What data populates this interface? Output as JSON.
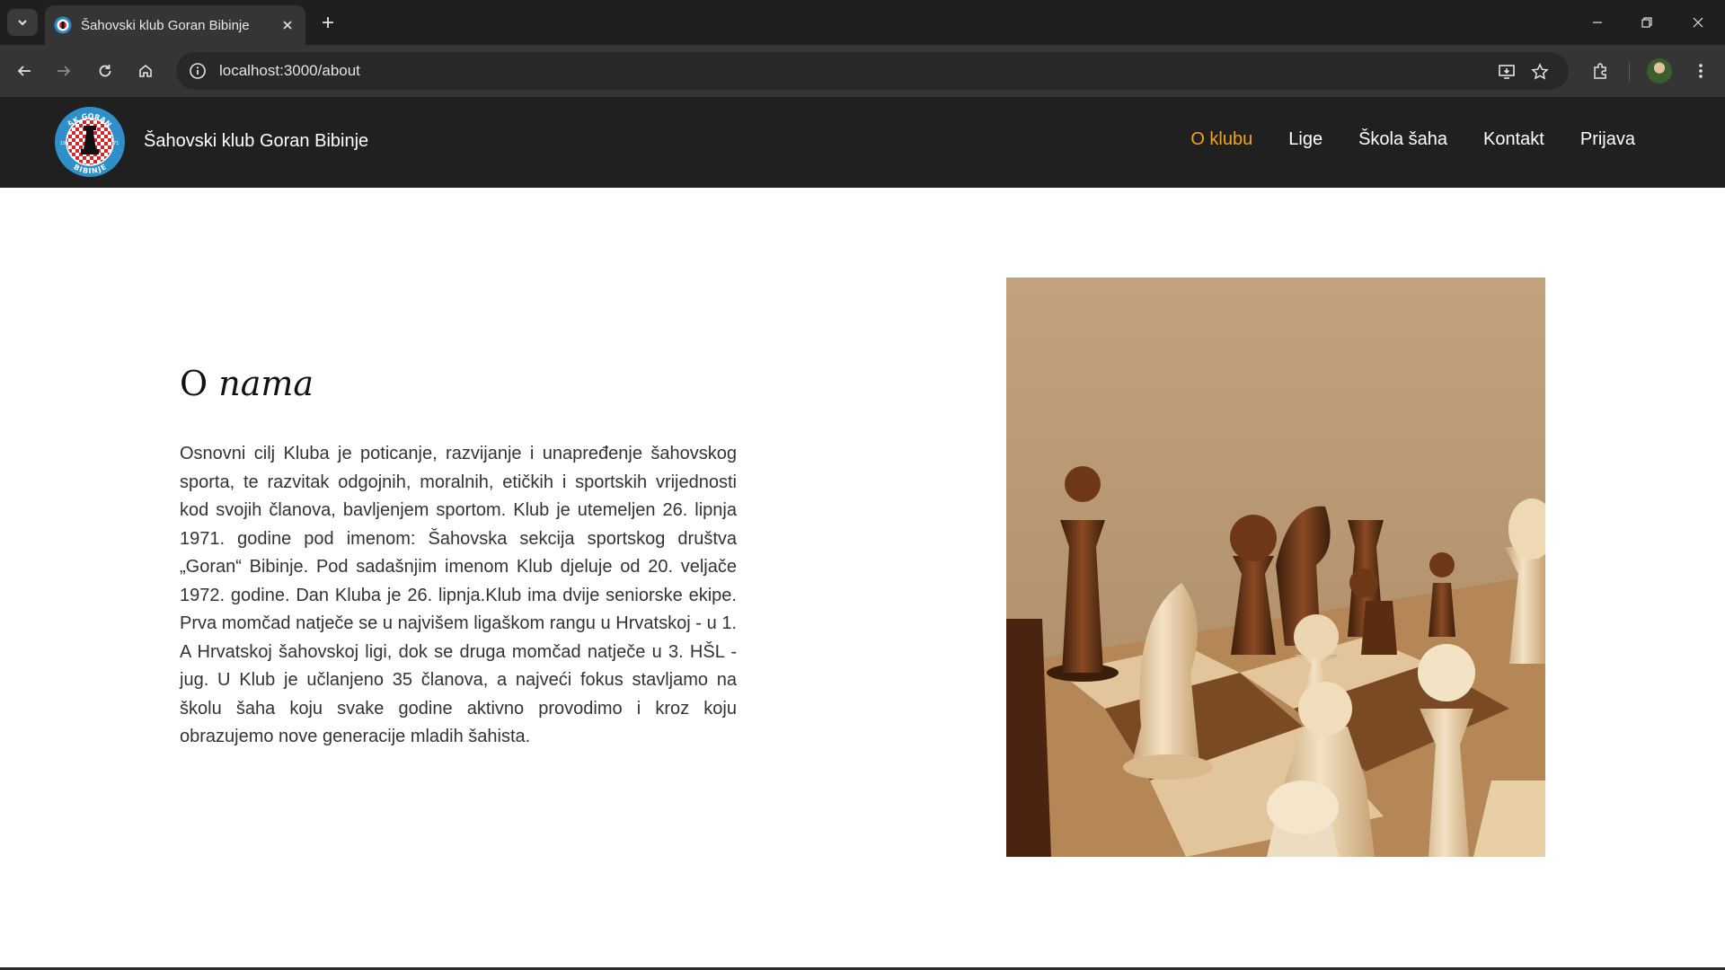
{
  "browser": {
    "tab_title": "Šahovski klub Goran Bibinje",
    "url": "localhost:3000/about"
  },
  "site": {
    "brand": "Šahovski klub Goran Bibinje",
    "logo_text": {
      "top": "ŠK GORAN",
      "bottom": "BIBINJE",
      "left": "19",
      "right": "71"
    },
    "nav": [
      {
        "label": "O klubu",
        "active": true
      },
      {
        "label": "Lige",
        "active": false
      },
      {
        "label": "Škola šaha",
        "active": false
      },
      {
        "label": "Kontakt",
        "active": false
      },
      {
        "label": "Prijava",
        "active": false
      }
    ],
    "accent_color": "#f5a31a"
  },
  "about": {
    "heading_word1": "O",
    "heading_word2": "nama",
    "paragraph": "Osnovni cilj Kluba je poticanje, razvijanje i unapređenje šahovskog sporta, te razvitak odgojnih, moralnih, etičkih i sportskih vrijednosti kod svojih članova, bavljenjem sportom. Klub je utemeljen 26. lipnja 1971. godine pod imenom: Šahovska sekcija sportskog društva „Goran“ Bibinje. Pod sadašnjim imenom Klub djeluje od 20. veljače 1972. godine. Dan Kluba je 26. lipnja.Klub ima dvije seniorske ekipe. Prva momčad natječe se u najvišem ligaškom rangu u Hrvatskoj - u 1. A Hrvatskoj šahovskoj ligi, dok se druga momčad natječe u 3. HŠL - jug. U Klub je učlanjeno 35 članova, a najveći fokus stavljamo na školu šaha koju svake godine aktivno provodimo i kroz koju obrazujemo nove generacije mladih šahista."
  }
}
